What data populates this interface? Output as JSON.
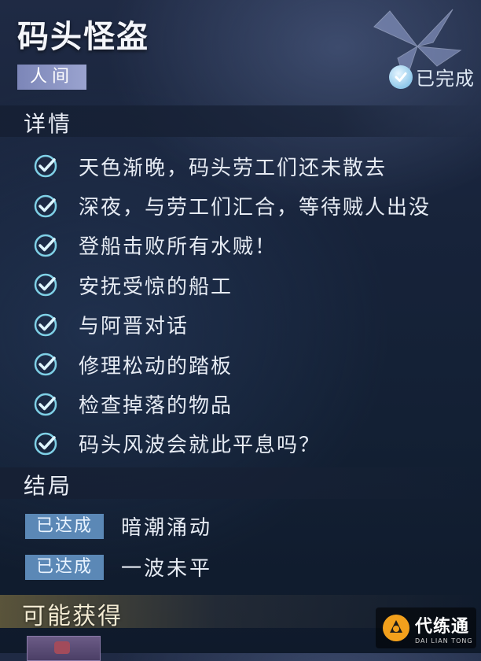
{
  "quest": {
    "title": "码头怪盗",
    "realm_tag": "人间",
    "status_label": "已完成"
  },
  "details": {
    "section_title": "详情",
    "items": [
      {
        "text": "天色渐晚，码头劳工们还未散去",
        "done": true
      },
      {
        "text": "深夜，与劳工们汇合，等待贼人出没",
        "done": true
      },
      {
        "text": "登船击败所有水贼！",
        "done": true
      },
      {
        "text": "安抚受惊的船工",
        "done": true
      },
      {
        "text": "与阿晋对话",
        "done": true
      },
      {
        "text": "修理松动的踏板",
        "done": true
      },
      {
        "text": "检查掉落的物品",
        "done": true
      },
      {
        "text": "码头风波会就此平息吗？",
        "done": true
      }
    ]
  },
  "endings": {
    "section_title": "结局",
    "items": [
      {
        "badge": "已达成",
        "text": "暗潮涌动"
      },
      {
        "badge": "已达成",
        "text": "一波未平"
      }
    ]
  },
  "rewards": {
    "section_title": "可能获得"
  },
  "watermark": {
    "name": "代练通",
    "pinyin": "DAI LIAN TONG"
  },
  "colors": {
    "background": "#17233a",
    "check": "#7fd0e6",
    "badge": "#5b88b6",
    "realm_tag": "#8a93c4",
    "rewards_bar": "#968246"
  }
}
